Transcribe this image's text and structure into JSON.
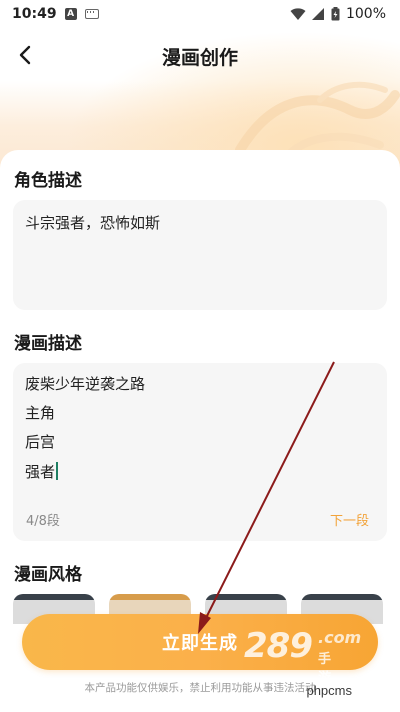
{
  "status_bar": {
    "time": "10:49",
    "battery": "100%",
    "icons": [
      "a-notification-icon",
      "keyboard-icon",
      "wifi-icon",
      "signal-icon",
      "battery-icon"
    ]
  },
  "header": {
    "title": "漫画创作",
    "back_icon": "chevron-left-icon"
  },
  "character": {
    "section_title": "角色描述",
    "value": "斗宗强者，恐怖如斯"
  },
  "comic": {
    "section_title": "漫画描述",
    "lines": [
      "废柴少年逆袭之路",
      "主角",
      "后宫",
      "强者"
    ],
    "segment_count": "4/8段",
    "next_segment_label": "下一段"
  },
  "style": {
    "section_title": "漫画风格"
  },
  "generate_button_label": "立即生成",
  "disclaimer": "本产品功能仅供娱乐，禁止利用功能从事违法活动",
  "watermark": {
    "big": "289",
    "com": ".com",
    "small": "手游网",
    "site": "phpcms"
  },
  "colors": {
    "accent": "#f7a534",
    "next_segment": "#f2a33a",
    "caret": "#1e7f63",
    "arrow": "#8b1a1a"
  }
}
